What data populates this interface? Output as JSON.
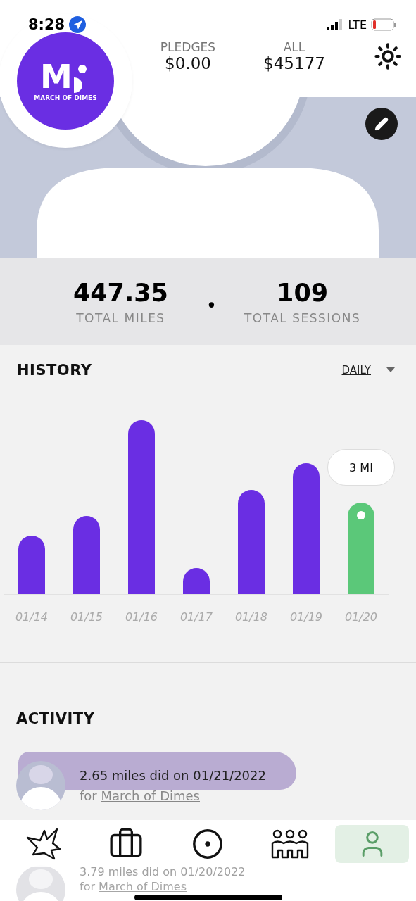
{
  "status_bar": {
    "time": "8:28",
    "network": "LTE"
  },
  "logo": {
    "mark": "M",
    "caption": "MARCH OF DIMES"
  },
  "header": {
    "stats": [
      {
        "label": "PLEDGES",
        "value": "$0.00"
      },
      {
        "label": "ALL",
        "value": "$45177"
      }
    ]
  },
  "totals": {
    "separator": "•",
    "items": [
      {
        "value": "447.35",
        "label": "TOTAL MILES"
      },
      {
        "value": "109",
        "label": "TOTAL SESSIONS"
      }
    ]
  },
  "history": {
    "title": "HISTORY",
    "period": "DAILY",
    "bars": [
      {
        "label": "01/14",
        "selected": false
      },
      {
        "label": "01/15",
        "selected": false
      },
      {
        "label": "01/16",
        "selected": false
      },
      {
        "label": "01/17",
        "selected": false
      },
      {
        "label": "01/18",
        "selected": false
      },
      {
        "label": "01/19",
        "selected": false
      },
      {
        "label": "01/20",
        "selected": true,
        "tooltip": "3 MI"
      }
    ]
  },
  "activity": {
    "title": "ACTIVITY",
    "items": [
      {
        "text": "2.65 miles did on 01/21/2022",
        "prefix": "for",
        "organization": "March of Dimes",
        "highlighted": true,
        "faded": false
      },
      {
        "text": "3.79 miles did on 01/20/2022",
        "prefix": "for",
        "organization": "March of Dimes",
        "highlighted": false,
        "faded": true
      }
    ]
  },
  "tab_bar": [
    {
      "kind": "burst",
      "selected": false
    },
    {
      "kind": "briefcase",
      "selected": false
    },
    {
      "kind": "target",
      "selected": false
    },
    {
      "kind": "group",
      "selected": false
    },
    {
      "kind": "profile",
      "selected": true
    }
  ]
}
